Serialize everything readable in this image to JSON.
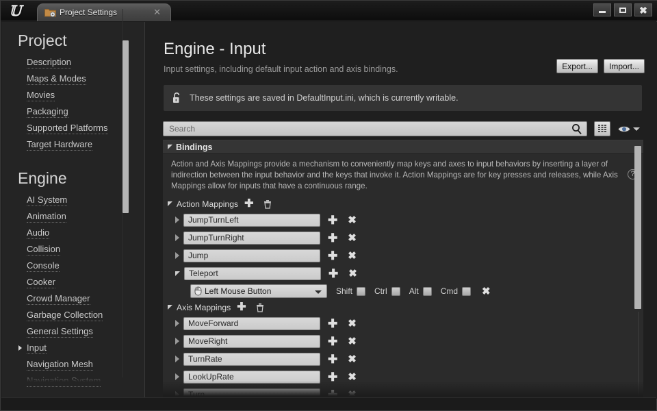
{
  "window": {
    "tab_title": "Project Settings",
    "tab_icon": "folder-gear-icon",
    "logo": "unreal-engine-logo",
    "minimize": "minimize-icon",
    "maximize": "maximize-icon",
    "close": "close-icon"
  },
  "sidebar": {
    "sections": [
      {
        "heading": "Project",
        "items": [
          {
            "label": "Description",
            "selected": false
          },
          {
            "label": "Maps & Modes",
            "selected": false
          },
          {
            "label": "Movies",
            "selected": false
          },
          {
            "label": "Packaging",
            "selected": false
          },
          {
            "label": "Supported Platforms",
            "selected": false
          },
          {
            "label": "Target Hardware",
            "selected": false
          }
        ]
      },
      {
        "heading": "Engine",
        "items": [
          {
            "label": "AI System",
            "selected": false
          },
          {
            "label": "Animation",
            "selected": false
          },
          {
            "label": "Audio",
            "selected": false
          },
          {
            "label": "Collision",
            "selected": false
          },
          {
            "label": "Console",
            "selected": false
          },
          {
            "label": "Cooker",
            "selected": false
          },
          {
            "label": "Crowd Manager",
            "selected": false
          },
          {
            "label": "Garbage Collection",
            "selected": false
          },
          {
            "label": "General Settings",
            "selected": false
          },
          {
            "label": "Input",
            "selected": true
          },
          {
            "label": "Navigation Mesh",
            "selected": false
          },
          {
            "label": "Navigation System",
            "selected": false
          }
        ]
      }
    ]
  },
  "main": {
    "title": "Engine - Input",
    "subtitle": "Input settings, including default input action and axis bindings.",
    "export_label": "Export...",
    "import_label": "Import...",
    "info": {
      "icon": "unlocked-padlock-icon",
      "message": "These settings are saved in DefaultInput.ini, which is currently writable."
    },
    "search": {
      "placeholder": "Search",
      "value": "",
      "search_icon": "magnifier-icon",
      "columns_icon": "grid-columns-icon",
      "visibility_icon": "eye-icon",
      "visibility_caret": "chevron-down-icon"
    },
    "category": {
      "name": "Bindings",
      "expanded": true,
      "description": "Action and Axis Mappings provide a mechanism to conveniently map keys and axes to input behaviors by inserting a layer of indirection between the input behavior and the keys that invoke it. Action Mappings are for key presses and releases, while Axis Mappings allow for inputs that have a continuous range.",
      "help_icon": "question-mark-icon"
    },
    "groups": [
      {
        "name": "Action Mappings",
        "expanded": true,
        "add_icon": "plus-icon",
        "delete_icon": "trash-icon",
        "rows": [
          {
            "name": "JumpTurnLeft",
            "expanded": false,
            "add_icon": "plus-icon",
            "remove_icon": "x-icon"
          },
          {
            "name": "JumpTurnRight",
            "expanded": false,
            "add_icon": "plus-icon",
            "remove_icon": "x-icon"
          },
          {
            "name": "Jump",
            "expanded": false,
            "add_icon": "plus-icon",
            "remove_icon": "x-icon"
          },
          {
            "name": "Teleport",
            "expanded": true,
            "add_icon": "plus-icon",
            "remove_icon": "x-icon"
          }
        ]
      },
      {
        "name": "Axis Mappings",
        "expanded": true,
        "add_icon": "plus-icon",
        "delete_icon": "trash-icon",
        "rows": [
          {
            "name": "MoveForward",
            "expanded": false,
            "add_icon": "plus-icon",
            "remove_icon": "x-icon"
          },
          {
            "name": "MoveRight",
            "expanded": false,
            "add_icon": "plus-icon",
            "remove_icon": "x-icon"
          },
          {
            "name": "TurnRate",
            "expanded": false,
            "add_icon": "plus-icon",
            "remove_icon": "x-icon"
          },
          {
            "name": "LookUpRate",
            "expanded": false,
            "add_icon": "plus-icon",
            "remove_icon": "x-icon"
          },
          {
            "name": "Turn",
            "expanded": false,
            "add_icon": "plus-icon",
            "remove_icon": "x-icon"
          }
        ]
      }
    ],
    "key_binding": {
      "key_icon": "mouse-icon",
      "key": "Left Mouse Button",
      "modifiers": [
        {
          "label": "Shift",
          "checked": false
        },
        {
          "label": "Ctrl",
          "checked": false
        },
        {
          "label": "Alt",
          "checked": false
        },
        {
          "label": "Cmd",
          "checked": false
        }
      ],
      "remove_icon": "x-icon"
    }
  }
}
